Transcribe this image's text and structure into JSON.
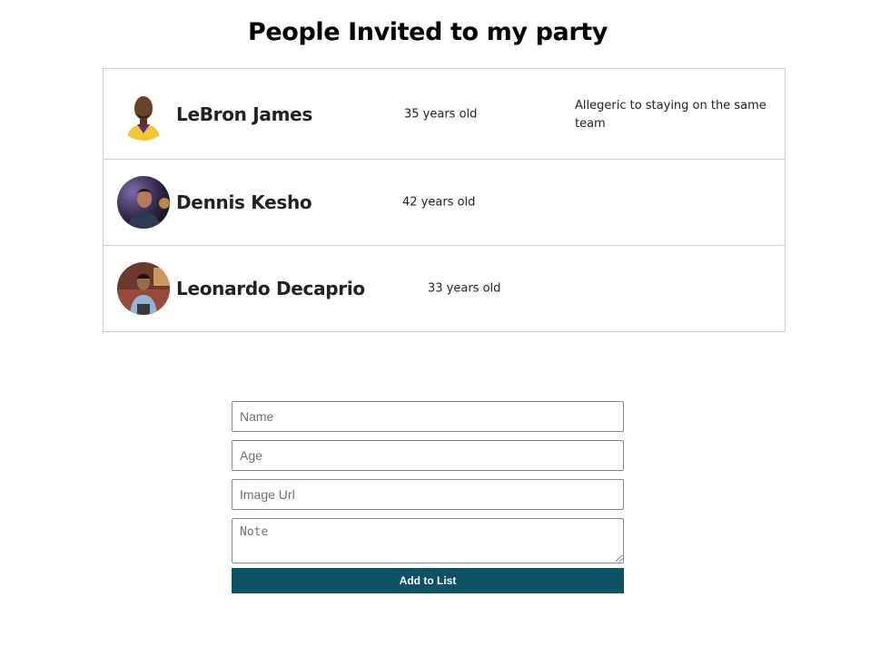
{
  "page": {
    "title": "People Invited to my party"
  },
  "guests": [
    {
      "name": "LeBron James",
      "age": "35 years old",
      "note": "Allegeric to staying on the same team"
    },
    {
      "name": "Dennis Kesho",
      "age": "42 years old",
      "note": ""
    },
    {
      "name": "Leonardo Decaprio",
      "age": "33 years old",
      "note": ""
    }
  ],
  "form": {
    "name_placeholder": "Name",
    "age_placeholder": "Age",
    "image_url_placeholder": "Image Url",
    "note_placeholder": "Note",
    "submit_label": "Add to List"
  },
  "colors": {
    "button_bg": "#0d5368",
    "border": "#cfcfcf"
  }
}
